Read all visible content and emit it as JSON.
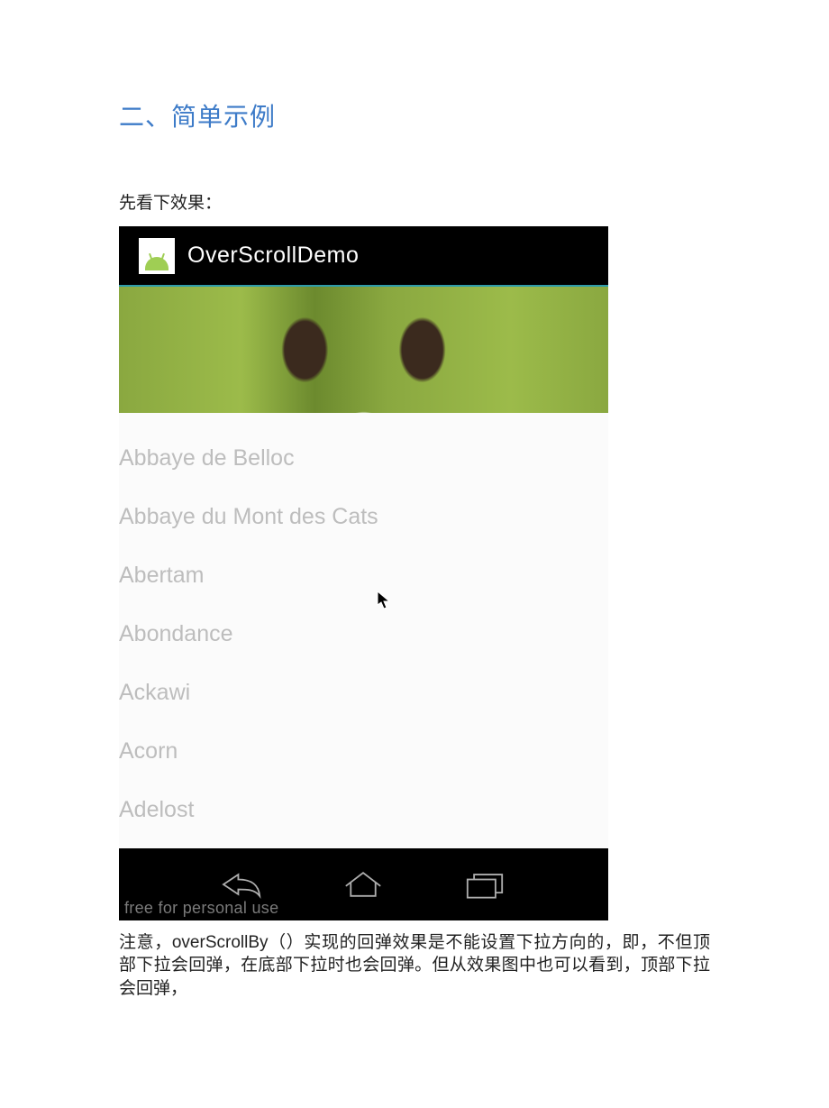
{
  "heading": "二、简单示例",
  "intro": "先看下效果：",
  "demo": {
    "appTitle": "OverScrollDemo",
    "listItems": [
      "Abbaye de Belloc",
      "Abbaye du Mont des Cats",
      "Abertam",
      "Abondance",
      "Ackawi",
      "Acorn",
      "Adelost"
    ],
    "watermark": "free for personal use"
  },
  "body": "注意，overScrollBy（）实现的回弹效果是不能设置下拉方向的，即，不但顶部下拉会回弹，在底部下拉时也会回弹。但从效果图中也可以看到，顶部下拉会回弹，"
}
